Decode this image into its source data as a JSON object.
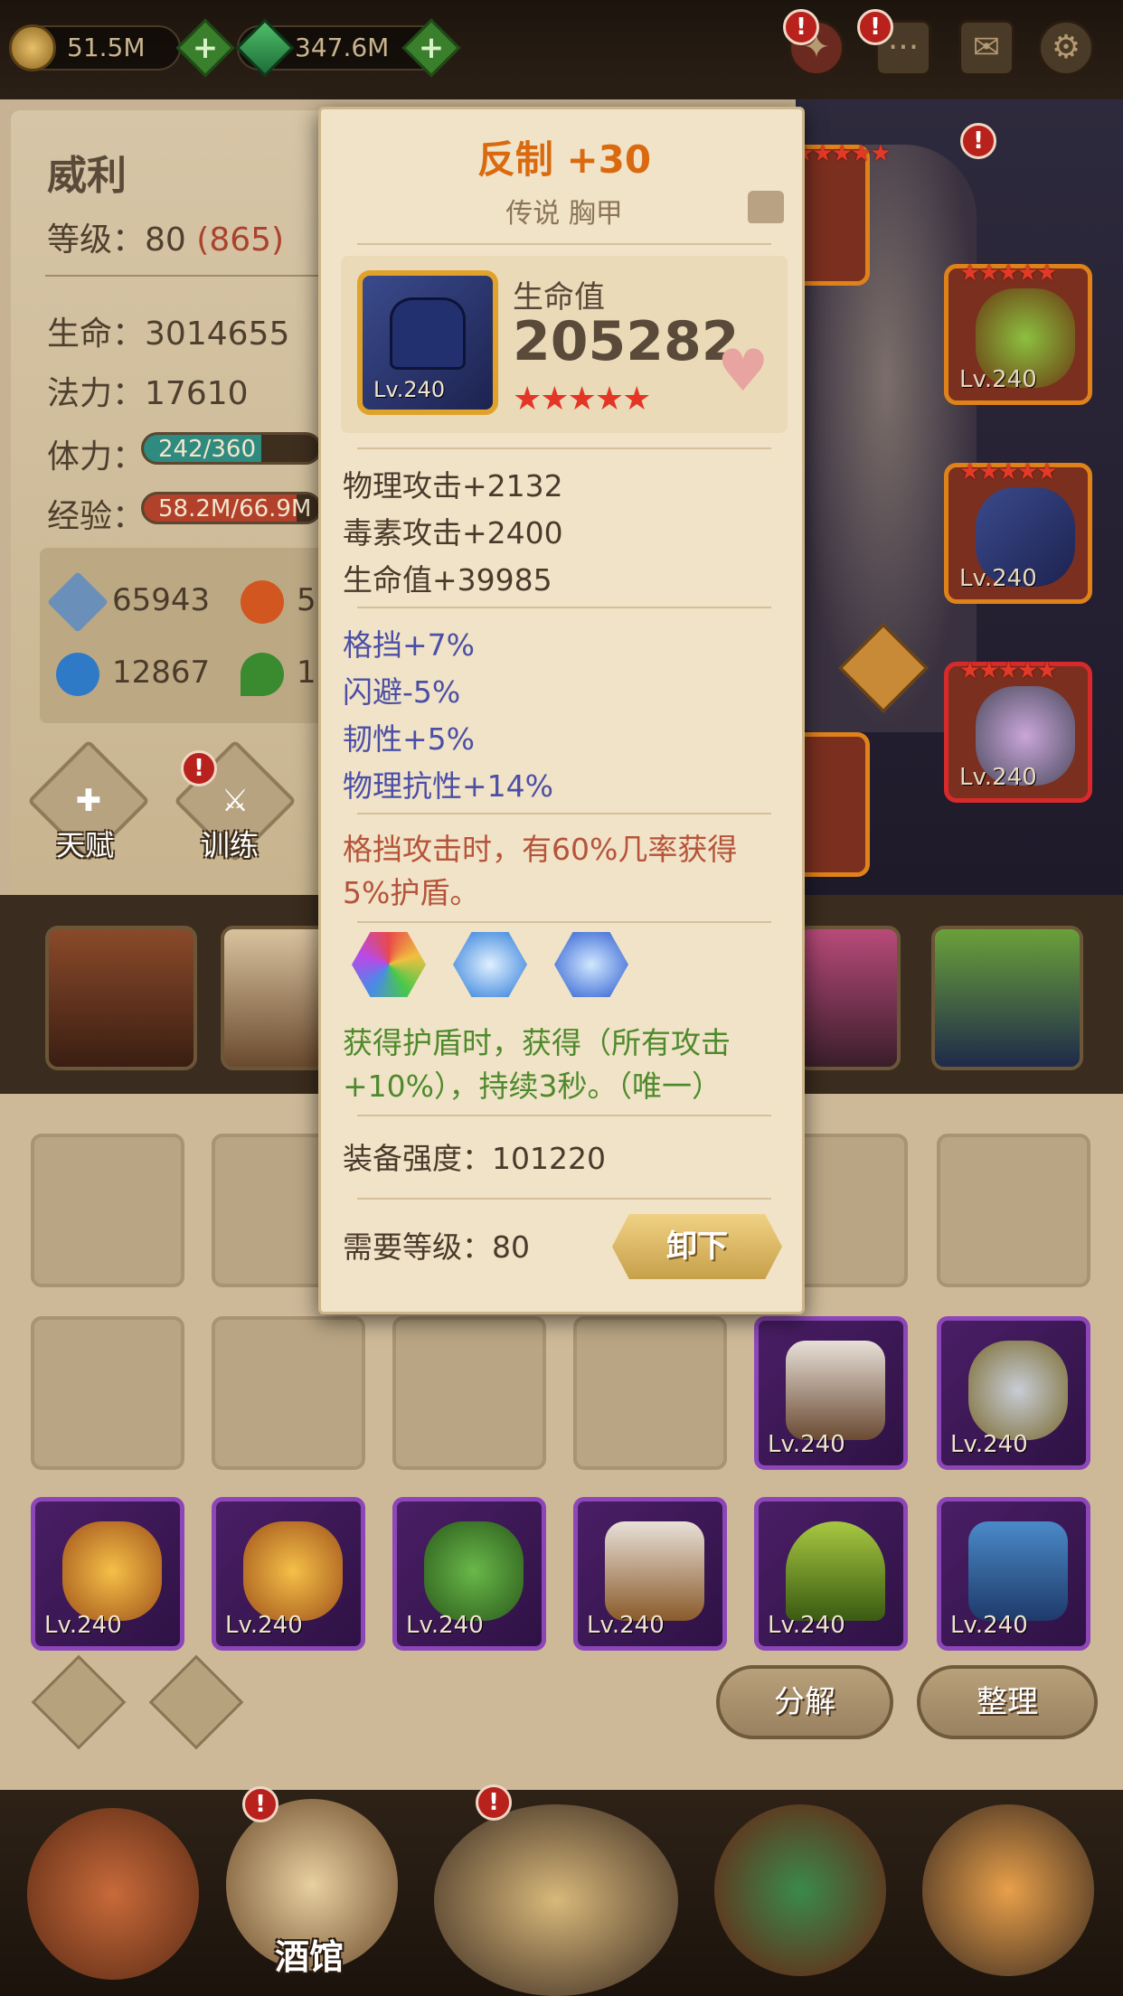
{
  "topbar": {
    "gold": "51.5M",
    "gems": "347.6M",
    "icons": [
      "coin-icon",
      "gem-icon",
      "plus-icon",
      "chat-icon",
      "mail-icon",
      "gear-icon"
    ],
    "alert_mark": "!"
  },
  "hero": {
    "name": "威利",
    "level_label": "等级：",
    "level": "80",
    "level_extra": "(865)",
    "hp_label": "生命：",
    "hp": "3014655",
    "mp_label": "法力：",
    "mp": "17610",
    "stamina_label": "体力：",
    "stamina": "242/360",
    "stamina_fraction": 0.67,
    "exp_label": "经验：",
    "exp": "58.2M/66.9M",
    "exp_fraction": 0.87,
    "sub_stats": [
      "65943",
      "5",
      "12867",
      "1"
    ],
    "buttons": {
      "talent": "天赋",
      "train": "训练"
    }
  },
  "tooltip": {
    "title": "反制 +30",
    "subtitle": "传说 胸甲",
    "main_stat_label": "生命值",
    "main_stat_value": "205282",
    "item_level": "Lv.240",
    "stars": "★★★★★",
    "base_stats": [
      "物理攻击+2132",
      "毒素攻击+2400",
      "生命值+39985"
    ],
    "bonus_stats": [
      "格挡+7%",
      "闪避-5%",
      "韧性+5%",
      "物理抗性+14%"
    ],
    "passive": [
      "格挡攻击时，有60%几率获得",
      "5%护盾。"
    ],
    "set_effect": [
      "获得护盾时，获得（所有攻击",
      "+10%），持续3秒。（唯一）"
    ],
    "power_label": "装备强度：",
    "power_value": "101220",
    "req_label": "需要等级：",
    "req_value": "80",
    "unequip_button": "卸下"
  },
  "equipment": {
    "level_text": "Lv.240",
    "stars": "★★★★★"
  },
  "inventory": {
    "level_text": "Lv.240",
    "decompose_button": "分解",
    "sort_button": "整理"
  },
  "bottom_nav": {
    "tavern": "酒馆"
  }
}
